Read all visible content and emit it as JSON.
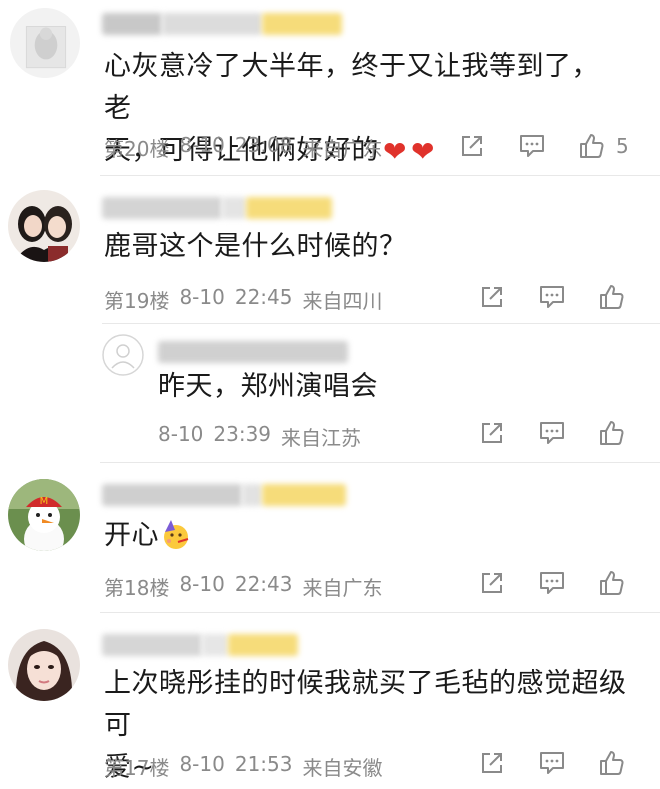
{
  "comments": [
    {
      "content_lines": [
        "心灰意冷了大半年，终于又让我等到了，老",
        "天，可得让他俩好好的"
      ],
      "floor": "第20楼",
      "date": "8-10",
      "time": "23:08",
      "location": "来自广东",
      "likes": "5"
    },
    {
      "content_lines": [
        "鹿哥这个是什么时候的？"
      ],
      "floor": "第19楼",
      "date": "8-10",
      "time": "22:45",
      "location": "来自四川",
      "likes": ""
    },
    {
      "content_lines": [
        "昨天，郑州演唱会"
      ],
      "floor": "",
      "date": "8-10",
      "time": "23:39",
      "location": "来自江苏",
      "likes": ""
    },
    {
      "content_lines": [
        "开心"
      ],
      "floor": "第18楼",
      "date": "8-10",
      "time": "22:43",
      "location": "来自广东",
      "likes": ""
    },
    {
      "content_lines": [
        "上次晓彤挂的时候我就买了毛毡的感觉超级可",
        "爱~"
      ],
      "floor": "第17楼",
      "date": "8-10",
      "time": "21:53",
      "location": "来自安徽",
      "likes": ""
    }
  ],
  "icons": {
    "share": "share-icon",
    "reply": "comment-icon",
    "like": "thumbs-up-icon",
    "heart": "heart-icon",
    "party": "party-face-icon"
  },
  "colors": {
    "text": "#1a1a1a",
    "meta": "#8a8a8a",
    "heart": "#e0322b",
    "vip_highlight": "#f6dc7a"
  }
}
